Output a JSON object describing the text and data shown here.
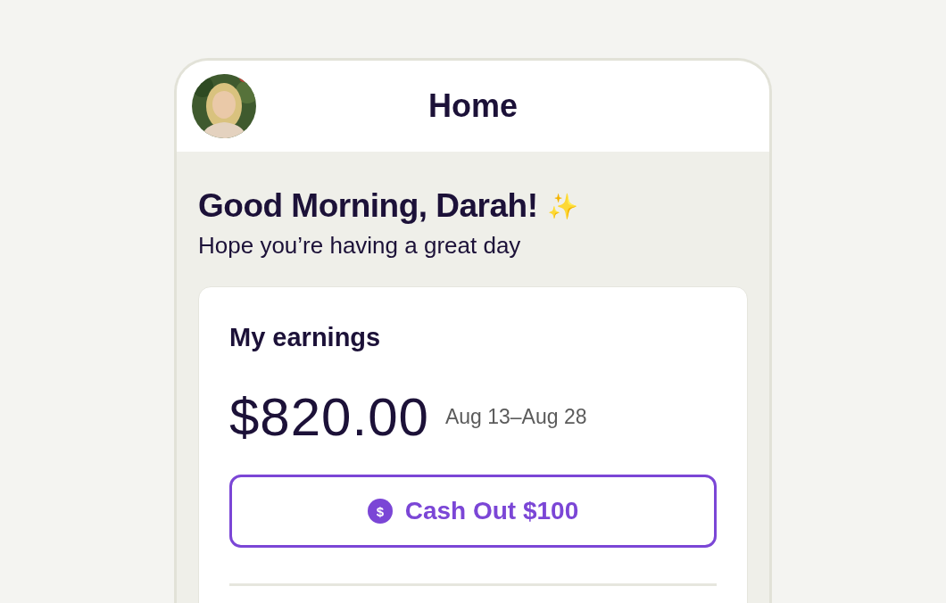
{
  "header": {
    "title": "Home"
  },
  "greeting": {
    "title": "Good Morning, Darah!",
    "emoji": "✨",
    "subtitle": "Hope you’re having a great day"
  },
  "earnings_card": {
    "title": "My earnings",
    "amount": "$820.00",
    "period": "Aug 13–Aug 28",
    "button": {
      "label": "Cash Out $100",
      "icon_glyph": "$"
    }
  }
}
